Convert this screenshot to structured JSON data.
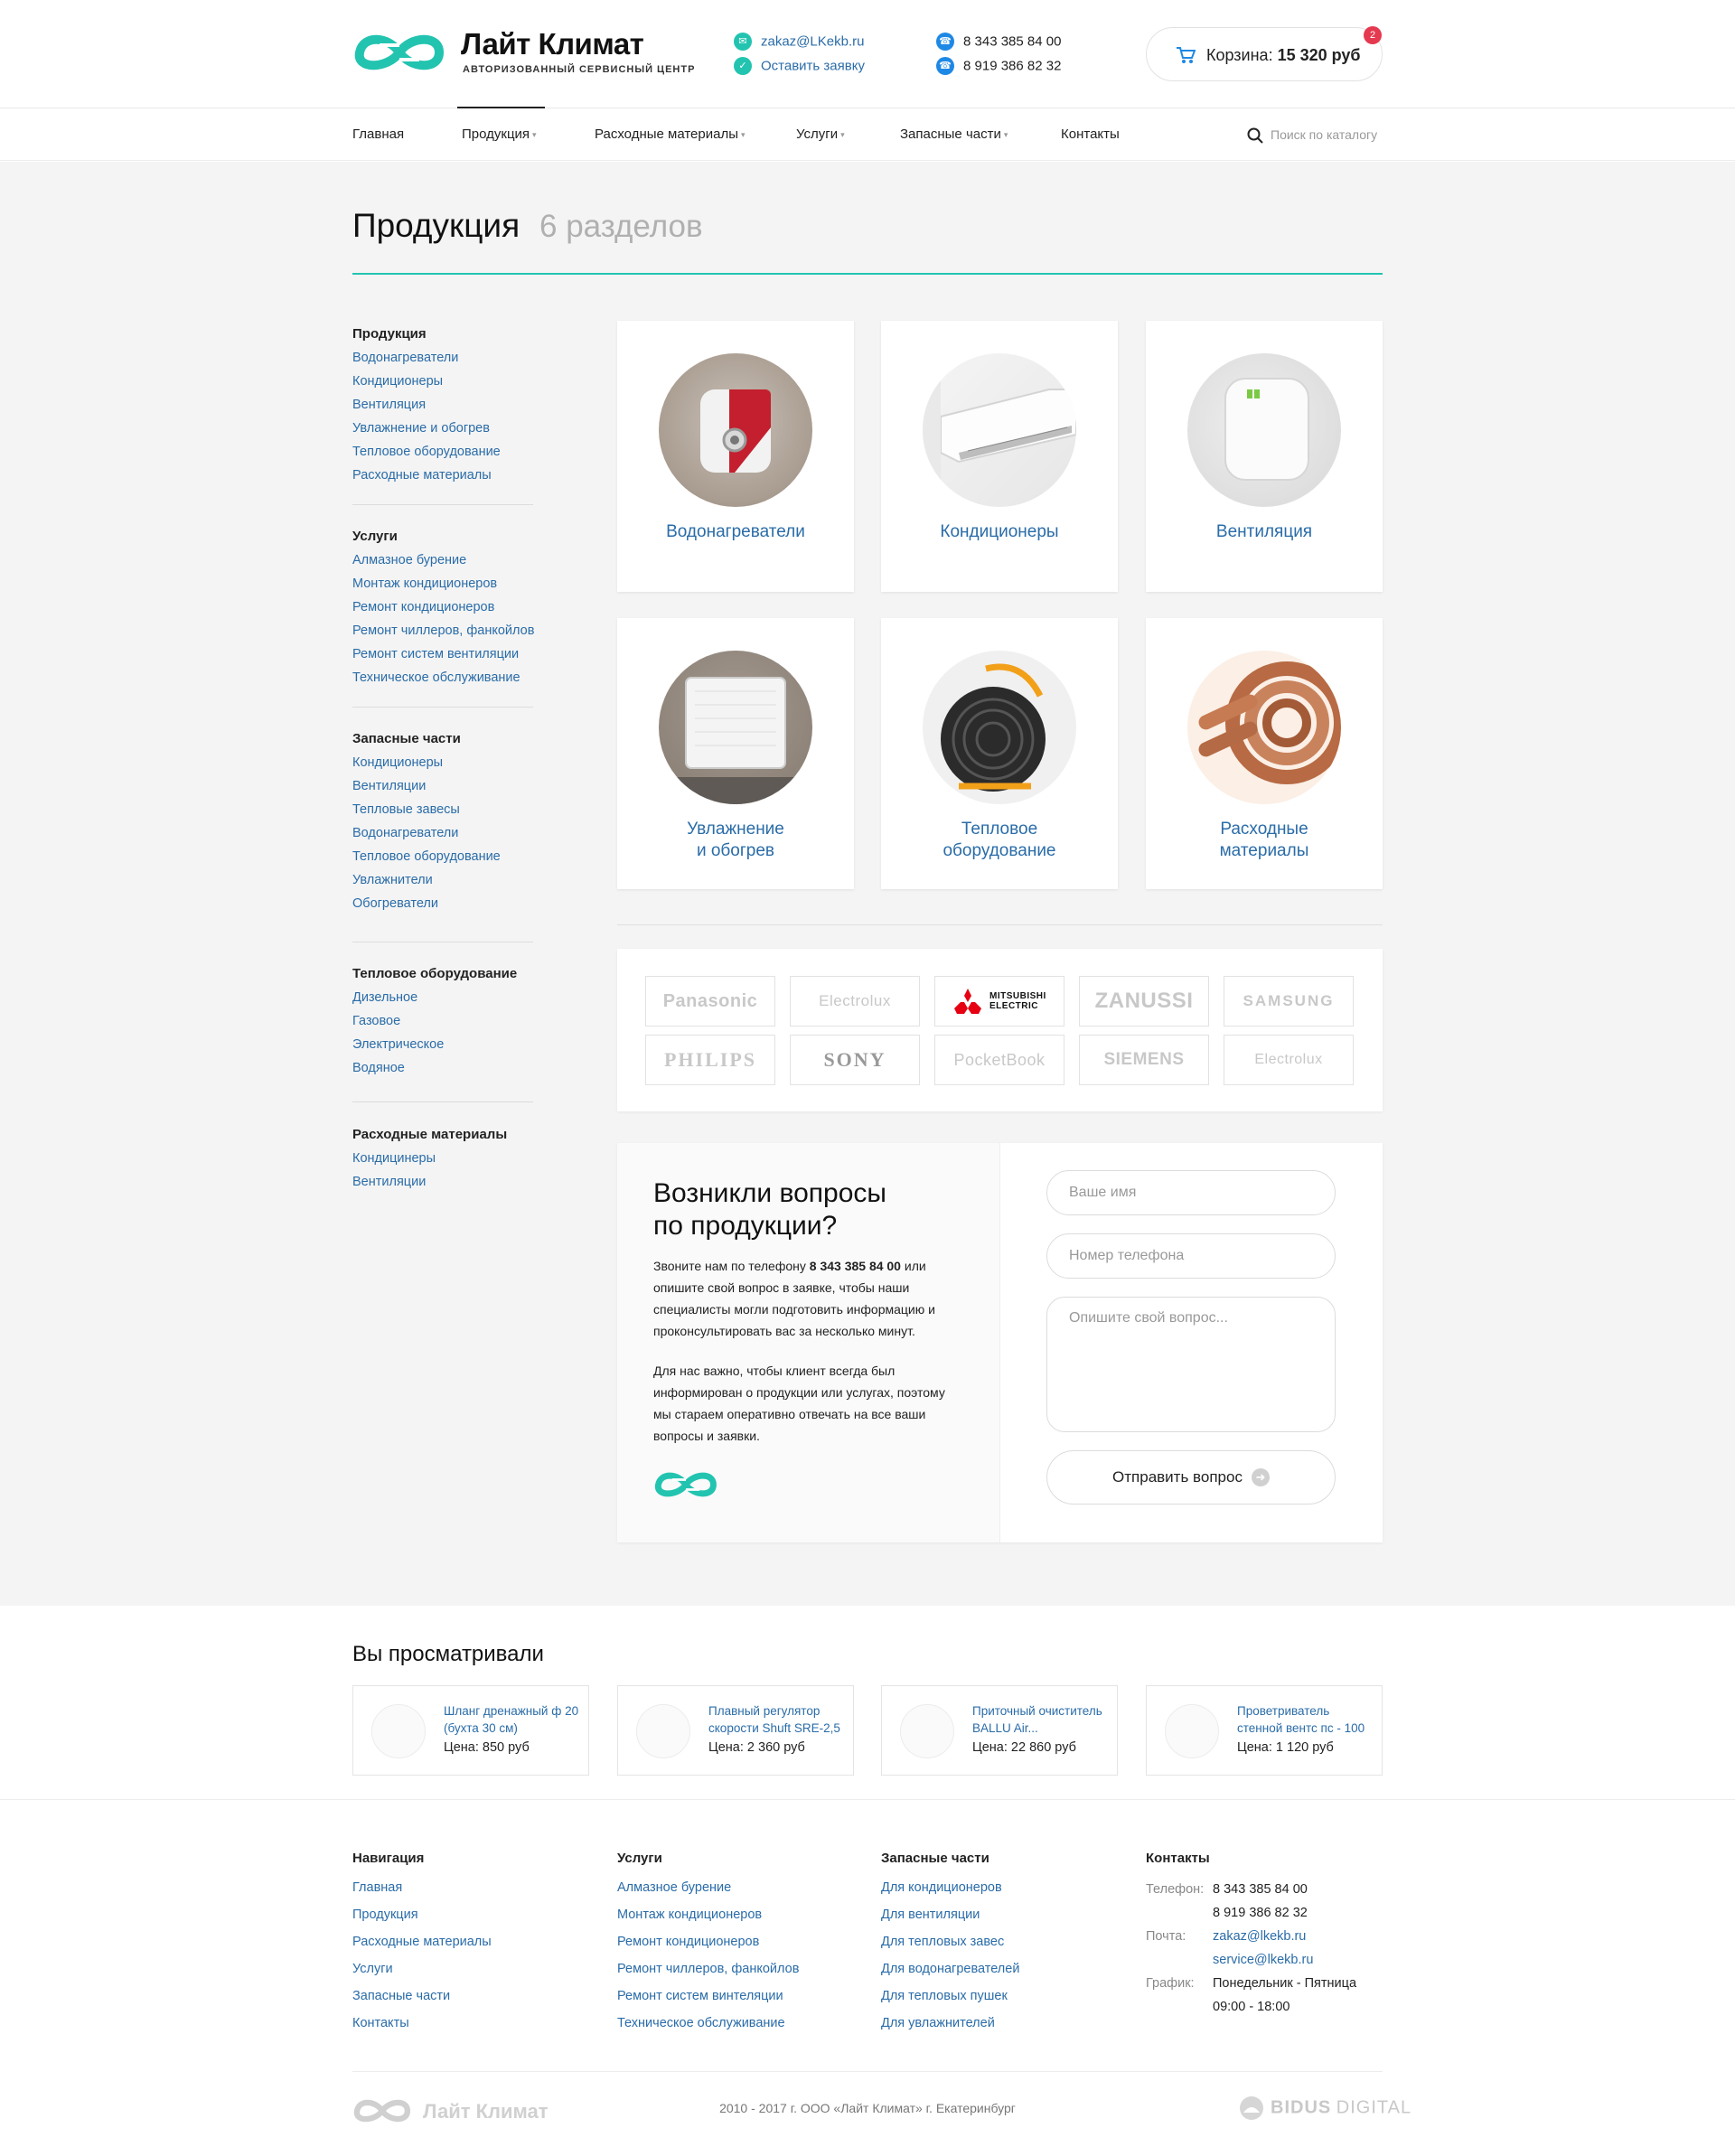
{
  "header": {
    "logo_title": "Лайт Климат",
    "logo_subtitle": "АВТОРИЗОВАННЫЙ СЕРВИСНЫЙ ЦЕНТР",
    "email": "zakaz@LKekb.ru",
    "request_link": "Оставить заявку",
    "phone1": "8 343 385 84 00",
    "phone2": "8 919 386 82 32",
    "cart_label": "Корзина:",
    "cart_total": "15 320 руб",
    "cart_count": "2"
  },
  "nav": {
    "items": [
      "Главная",
      "Продукция",
      "Расходные материалы",
      "Услуги",
      "Запасные части",
      "Контакты"
    ],
    "search_placeholder": "Поиск по каталогу"
  },
  "page": {
    "title": "Продукция",
    "count": "6 разделов"
  },
  "sidebar": [
    {
      "title": "Продукция",
      "links": [
        "Водонагреватели",
        "Кондиционеры",
        "Вентиляция",
        "Увлажнение и обогрев",
        "Тепловое оборудование",
        "Расходные материалы"
      ]
    },
    {
      "title": "Услуги",
      "links": [
        "Алмазное бурение",
        "Монтаж кондиционеров",
        "Ремонт кондиционеров",
        "Ремонт чиллеров, фанкойлов",
        "Ремонт систем вентиляции",
        "Техническое обслуживание"
      ]
    },
    {
      "title": "Запасные части",
      "links": [
        "Кондиционеры",
        "Вентиляции",
        "Тепловые завесы",
        "Водонагреватели",
        "Тепловое оборудование",
        "Увлажнители",
        "Обогреватели"
      ]
    },
    {
      "title": "Тепловое оборудование",
      "links": [
        "Дизельное",
        "Газовое",
        "Электрическое",
        "Водяное"
      ]
    },
    {
      "title": "Расходные материалы",
      "links": [
        "Кондицинеры",
        "Вентиляции"
      ]
    }
  ],
  "categories": [
    {
      "line1": "Водонагреватели",
      "line2": "",
      "icon": "water-heater-image"
    },
    {
      "line1": "Кондиционеры",
      "line2": "",
      "icon": "air-conditioner-image"
    },
    {
      "line1": "Вентиляция",
      "line2": "",
      "icon": "ventilation-image"
    },
    {
      "line1": "Увлажнение",
      "line2": "и обогрев",
      "icon": "heater-image"
    },
    {
      "line1": "Тепловое",
      "line2": "оборудование",
      "icon": "heat-gun-image"
    },
    {
      "line1": "Расходные",
      "line2": "материалы",
      "icon": "copper-pipes-image"
    }
  ],
  "brands": [
    "Panasonic",
    "Electrolux",
    "MITSUBISHI ELECTRIC",
    "ZANUSSI",
    "SAMSUNG",
    "PHILIPS",
    "SONY",
    "PocketBook",
    "SIEMENS",
    "Electrolux"
  ],
  "question": {
    "title_line1": "Возникли вопросы",
    "title_line2": "по продукции?",
    "p1_start": "Звоните нам по телефону ",
    "p1_phone": "8 343 385 84 00",
    "p1_end": " или опишите свой вопрос в заявке, чтобы наши специалисты могли подготовить информацию и проконсультировать вас за несколько минут.",
    "p2": "Для нас важно, чтобы клиент всегда был информирован о продукции или услугах, поэтому мы стараем оперативно отвечать на все ваши вопросы и заявки.",
    "name_placeholder": "Ваше имя",
    "phone_placeholder": "Номер телефона",
    "question_placeholder": "Опишите свой вопрос...",
    "submit_label": "Отправить вопрос"
  },
  "viewed": {
    "title": "Вы просматривали",
    "items": [
      {
        "name": "Шланг дренажный ф 20 (бухта 30 см)",
        "price": "Цена: 850 руб"
      },
      {
        "name": "Плавный регулятор скорости Shuft SRE-2,5",
        "price": "Цена: 2 360 руб"
      },
      {
        "name": "Приточный очиститель BALLU Air...",
        "price": "Цена: 22 860 руб"
      },
      {
        "name": "Проветриватель стенной вентс пс - 100",
        "price": "Цена: 1 120 руб"
      }
    ]
  },
  "footer": {
    "nav_title": "Навигация",
    "nav_links": [
      "Главная",
      "Продукция",
      "Расходные материалы",
      "Услуги",
      "Запасные части",
      "Контакты"
    ],
    "services_title": "Услуги",
    "services_links": [
      "Алмазное бурение",
      "Монтаж кондиционеров",
      "Ремонт кондиционеров",
      "Ремонт чиллеров, фанкойлов",
      "Ремонт систем винтеляции",
      "Техническое обслуживание"
    ],
    "parts_title": "Запасные части",
    "parts_links": [
      "Для кондиционеров",
      "Для вентиляции",
      "Для тепловых завес",
      "Для водонагревателей",
      "Для тепловых пушек",
      "Для увлажнителей"
    ],
    "contacts_title": "Контакты",
    "phone_label": "Телефон:",
    "phone1": "8 343 385 84 00",
    "phone2": "8 919 386 82 32",
    "mail_label": "Почта:",
    "mail1": "zakaz@lkekb.ru",
    "mail2": "service@lkekb.ru",
    "schedule_label": "График:",
    "schedule1": "Понедельник - Пятница",
    "schedule2": "09:00 - 18:00",
    "logo_title": "Лайт Климат",
    "copyright": "2010 - 2017 г. ООО «Лайт Климат» г. Екатеринбург",
    "dev_bold": "BIDUS",
    "dev_light": "DIGITAL"
  },
  "colors": {
    "accent": "#22c4b0",
    "link": "#2a6ca8",
    "badge": "#e53950",
    "phone_dot": "#1e88e5"
  }
}
